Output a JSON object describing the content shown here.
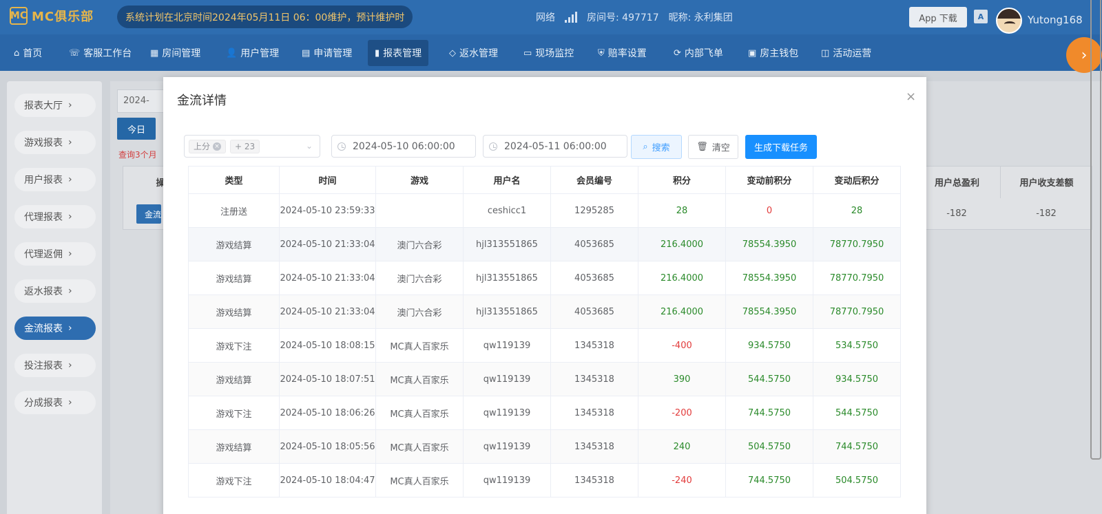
{
  "header": {
    "logo_mark": "MC",
    "logo_text": "MC俱乐部",
    "notice": "系统计划在北京时间2024年05月11日 06：00维护，预计维护时",
    "network_label": "网络",
    "room_label": "房间号: 497717",
    "nickname_label": "昵称: 永利集团",
    "app_download": "App 下载",
    "translate_icon_text": "A",
    "username": "Yutong168"
  },
  "nav": {
    "items": [
      {
        "label": "首页",
        "icon": "⌂"
      },
      {
        "label": "客服工作台",
        "icon": "☏"
      },
      {
        "label": "房间管理",
        "icon": "▦"
      },
      {
        "label": "用户管理",
        "icon": "👤"
      },
      {
        "label": "申请管理",
        "icon": "▤"
      },
      {
        "label": "报表管理",
        "icon": "▮"
      },
      {
        "label": "返水管理",
        "icon": "◇"
      },
      {
        "label": "现场监控",
        "icon": "▭"
      },
      {
        "label": "赔率设置",
        "icon": "⛨"
      },
      {
        "label": "内部飞单",
        "icon": "⟳"
      },
      {
        "label": "房主钱包",
        "icon": "▣"
      },
      {
        "label": "活动运营",
        "icon": "◫"
      }
    ],
    "active": "报表管理",
    "collapse_icon": "›"
  },
  "sidebar": {
    "items": [
      {
        "label": "报表大厅"
      },
      {
        "label": "游戏报表"
      },
      {
        "label": "用户报表"
      },
      {
        "label": "代理报表"
      },
      {
        "label": "代理返佣"
      },
      {
        "label": "返水报表"
      },
      {
        "label": "金流报表"
      },
      {
        "label": "投注报表"
      },
      {
        "label": "分成报表"
      }
    ],
    "active": "金流报表",
    "chevron": "›"
  },
  "background": {
    "date_partial": "2024-",
    "today_button": "今日",
    "warning": "查询3个月",
    "col_partial": "操",
    "btn_partial": "金流",
    "col_profit": "用户总盈利",
    "col_diff": "用户收支差额",
    "profit_value": "-182",
    "diff_value": "-182"
  },
  "modal": {
    "title": "金流详情",
    "close_icon": "×",
    "filter": {
      "tag": "上分",
      "more_tag": "+ 23",
      "start_date": "2024-05-10 06:00:00",
      "end_date": "2024-05-11 06:00:00",
      "search_label": "搜索",
      "clear_label": "清空",
      "generate_label": "生成下载任务"
    },
    "columns": [
      "类型",
      "时间",
      "游戏",
      "用户名",
      "会员编号",
      "积分",
      "变动前积分",
      "变动后积分"
    ],
    "rows": [
      {
        "type": "注册送",
        "time": "2024-05-10 23:59:33",
        "game": "",
        "user": "ceshicc1",
        "member": "1295285",
        "points": "28",
        "before": "0",
        "after": "28"
      },
      {
        "type": "游戏结算",
        "time": "2024-05-10 21:33:04",
        "game": "澳门六合彩",
        "user": "hjl313551865",
        "member": "4053685",
        "points": "216.4000",
        "before": "78554.3950",
        "after": "78770.7950"
      },
      {
        "type": "游戏结算",
        "time": "2024-05-10 21:33:04",
        "game": "澳门六合彩",
        "user": "hjl313551865",
        "member": "4053685",
        "points": "216.4000",
        "before": "78554.3950",
        "after": "78770.7950"
      },
      {
        "type": "游戏结算",
        "time": "2024-05-10 21:33:04",
        "game": "澳门六合彩",
        "user": "hjl313551865",
        "member": "4053685",
        "points": "216.4000",
        "before": "78554.3950",
        "after": "78770.7950"
      },
      {
        "type": "游戏下注",
        "time": "2024-05-10 18:08:15",
        "game": "MC真人百家乐",
        "user": "qw119139",
        "member": "1345318",
        "points": "-400",
        "before": "934.5750",
        "after": "534.5750"
      },
      {
        "type": "游戏结算",
        "time": "2024-05-10 18:07:51",
        "game": "MC真人百家乐",
        "user": "qw119139",
        "member": "1345318",
        "points": "390",
        "before": "544.5750",
        "after": "934.5750"
      },
      {
        "type": "游戏下注",
        "time": "2024-05-10 18:06:26",
        "game": "MC真人百家乐",
        "user": "qw119139",
        "member": "1345318",
        "points": "-200",
        "before": "744.5750",
        "after": "544.5750"
      },
      {
        "type": "游戏结算",
        "time": "2024-05-10 18:05:56",
        "game": "MC真人百家乐",
        "user": "qw119139",
        "member": "1345318",
        "points": "240",
        "before": "504.5750",
        "after": "744.5750"
      },
      {
        "type": "游戏下注",
        "time": "2024-05-10 18:04:47",
        "game": "MC真人百家乐",
        "user": "qw119139",
        "member": "1345318",
        "points": "-240",
        "before": "744.5750",
        "after": "504.5750"
      }
    ]
  },
  "colors": {
    "positive": "#2a8a2a",
    "negative": "#e23b3b",
    "primary": "#1890ff",
    "header_bg": "#2e6db0"
  }
}
